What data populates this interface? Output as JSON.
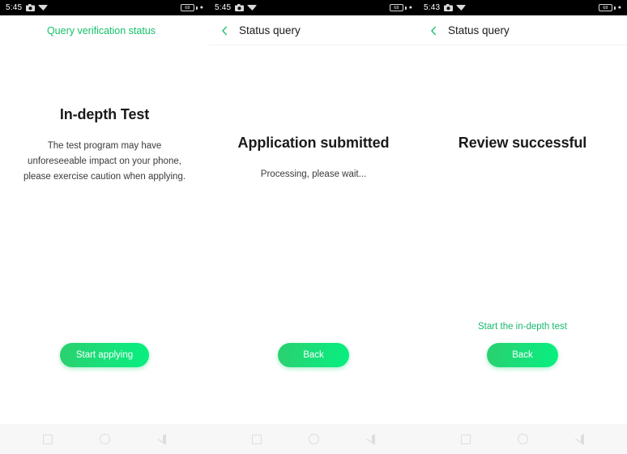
{
  "panels": [
    {
      "status_bar": {
        "time": "5:45",
        "icons": [
          "camera-icon",
          "wifi-signal-icon"
        ],
        "battery_level": "68",
        "battery_charging": true
      },
      "header": {
        "type": "link",
        "link_label": "Query verification status",
        "link_color": "#14c06a"
      },
      "title": "In-depth Test",
      "description": "The test program may have unforeseeable impact on your phone, please exercise caution when applying.",
      "footer_link": "",
      "button_label": "Start applying"
    },
    {
      "status_bar": {
        "time": "5:45",
        "icons": [
          "camera-icon",
          "wifi-signal-icon"
        ],
        "battery_level": "68",
        "battery_charging": true
      },
      "header": {
        "type": "back",
        "title": "Status query",
        "back_icon": "chevron-left-icon",
        "back_icon_color": "#14c06a"
      },
      "title": "Application submitted",
      "description": "Processing, please wait...",
      "footer_link": "",
      "button_label": "Back"
    },
    {
      "status_bar": {
        "time": "5:43",
        "icons": [
          "camera-icon",
          "wifi-signal-icon"
        ],
        "battery_level": "68",
        "battery_charging": true
      },
      "header": {
        "type": "back",
        "title": "Status query",
        "back_icon": "chevron-left-icon",
        "back_icon_color": "#14c06a"
      },
      "title": "Review successful",
      "description": "",
      "footer_link": "Start the in-depth test",
      "button_label": "Back"
    }
  ],
  "nav_bar": {
    "recents_icon": "square-icon",
    "home_icon": "circle-icon",
    "back_icon": "triangle-left-icon"
  },
  "colors": {
    "accent_green": "#14c06a",
    "button_gradient_start": "#2bd06f",
    "button_gradient_end": "#07f07f",
    "status_bar_bg": "#000000",
    "nav_bar_bg": "#f7f7f7"
  }
}
